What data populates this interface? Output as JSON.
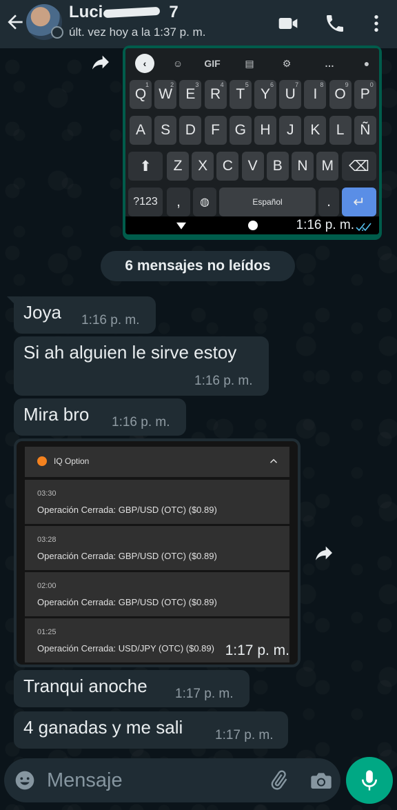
{
  "header": {
    "contact_name": "Luci",
    "contact_name_suffix": "7",
    "last_seen": "últ. vez hoy a la 1:37 p. m."
  },
  "keyboard_image": {
    "toolbar": [
      "GIF"
    ],
    "rows": [
      [
        {
          "k": "Q",
          "s": "1"
        },
        {
          "k": "W",
          "s": "2"
        },
        {
          "k": "E",
          "s": "3"
        },
        {
          "k": "R",
          "s": "4"
        },
        {
          "k": "T",
          "s": "5"
        },
        {
          "k": "Y",
          "s": "6"
        },
        {
          "k": "U",
          "s": "7"
        },
        {
          "k": "I",
          "s": "8"
        },
        {
          "k": "O",
          "s": "9"
        },
        {
          "k": "P",
          "s": "0"
        }
      ],
      [
        {
          "k": "A"
        },
        {
          "k": "S"
        },
        {
          "k": "D"
        },
        {
          "k": "F"
        },
        {
          "k": "G"
        },
        {
          "k": "H"
        },
        {
          "k": "J"
        },
        {
          "k": "K"
        },
        {
          "k": "L"
        },
        {
          "k": "Ñ"
        }
      ],
      [
        {
          "k": "Z"
        },
        {
          "k": "X"
        },
        {
          "k": "C"
        },
        {
          "k": "V"
        },
        {
          "k": "B"
        },
        {
          "k": "N"
        },
        {
          "k": "M"
        }
      ]
    ],
    "symbols_key": "?123",
    "comma_key": ",",
    "space_key": "Español",
    "period_key": ".",
    "time": "1:16 p. m."
  },
  "unread_banner": "6 mensajes no leídos",
  "messages": [
    {
      "text": "Joya",
      "time": "1:16 p. m."
    },
    {
      "text": "Si ah alguien le sirve estoy",
      "time": "1:16 p. m."
    },
    {
      "text": "Mira bro",
      "time": "1:16 p. m."
    },
    {
      "text": "Tranqui anoche",
      "time": "1:17 p. m."
    },
    {
      "text": "4 ganadas y me sali",
      "time": "1:17 p. m."
    }
  ],
  "iq_image": {
    "app_name": "IQ Option",
    "items": [
      {
        "time": "03:30",
        "text": "Operación Cerrada: GBP/USD (OTC) ($0.89)"
      },
      {
        "time": "03:28",
        "text": "Operación Cerrada: GBP/USD (OTC) ($0.89)"
      },
      {
        "time": "02:00",
        "text": "Operación Cerrada: GBP/USD (OTC) ($0.89)"
      },
      {
        "time": "01:25",
        "text": "Operación Cerrada: USD/JPY (OTC) ($0.89)"
      }
    ],
    "time": "1:17 p. m."
  },
  "composer": {
    "placeholder": "Mensaje"
  },
  "colors": {
    "header_bg": "#1f2c34",
    "incoming_bubble": "#202c33",
    "outgoing_bubble": "#005c4b",
    "accent_green": "#00a884",
    "read_ticks": "#53bdeb"
  }
}
